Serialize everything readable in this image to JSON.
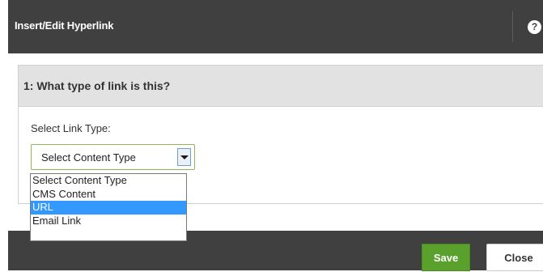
{
  "dialog": {
    "title": "Insert/Edit Hyperlink",
    "help_glyph": "?",
    "help_icon": "question-circle-icon"
  },
  "step": {
    "header": "1: What type of link is this?",
    "field_label": "Select Link Type:",
    "select": {
      "value": "Select Content Type",
      "arrow_icon": "chevron-down-icon"
    },
    "dropdown": {
      "options": [
        {
          "label": "Select Content Type"
        },
        {
          "label": "CMS Content"
        },
        {
          "label": "URL"
        },
        {
          "label": "Email Link"
        }
      ],
      "highlighted_index": 2
    }
  },
  "footer": {
    "save_label": "Save",
    "close_label": "Close"
  },
  "colors": {
    "titlebar": "#404040",
    "panel_header": "#e2e2e2",
    "save_button": "#5aa02c",
    "dropdown_highlight": "#3399ff",
    "select_border": "#8cb85a"
  }
}
